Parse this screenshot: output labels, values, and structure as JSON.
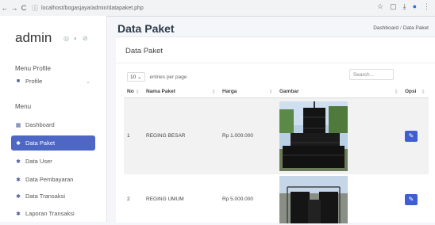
{
  "browser": {
    "url": "localhost/bogasjaya/admin/datapaket.php",
    "back": "←",
    "forward": "→",
    "reload": "C"
  },
  "sidebar": {
    "brand": "admin",
    "section_profile": "Menu Profile",
    "profile_label": "Profile",
    "section_menu": "Menu",
    "items": [
      {
        "label": "Dashboard",
        "icon": "grid-icon"
      },
      {
        "label": "Data Paket",
        "icon": "gear-icon",
        "active": true
      },
      {
        "label": "Data User",
        "icon": "gear-icon"
      },
      {
        "label": "Data Pembayaran",
        "icon": "gear-icon"
      },
      {
        "label": "Data Transaksi",
        "icon": "gear-icon"
      },
      {
        "label": "Laporan Transaksi",
        "icon": "gear-icon"
      }
    ]
  },
  "page": {
    "title": "Data Paket",
    "breadcrumb_home": "Dashboard",
    "breadcrumb_sep": "/",
    "breadcrumb_current": "Data Paket"
  },
  "card": {
    "title": "Data Paket",
    "entries_value": "10",
    "entries_label": "entries per page",
    "search_placeholder": "Search..."
  },
  "table": {
    "headers": [
      "No",
      "Nama Paket",
      "Harga",
      "Gambar",
      "Opsi"
    ],
    "rows": [
      {
        "no": "1",
        "nama": "REGING BESAR",
        "harga": "Rp 1.000.000"
      },
      {
        "no": "2",
        "nama": "REGING UMUM",
        "harga": "Rp 5.000.000"
      }
    ]
  },
  "colors": {
    "accent": "#4e66c4",
    "button": "#3f5fcf"
  }
}
